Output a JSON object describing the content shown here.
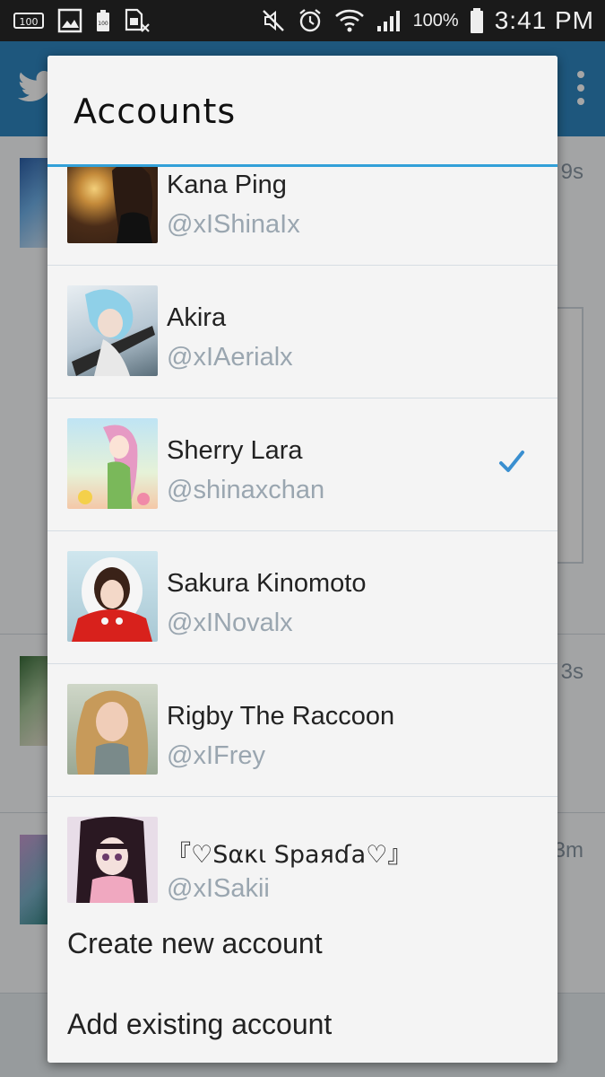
{
  "status_bar": {
    "battery_percent": "100%",
    "time": "3:41 PM",
    "icons": [
      "storage-100-icon",
      "gallery-icon",
      "battery-100-icon",
      "sim-card-icon",
      "mute-icon",
      "alarm-icon",
      "wifi-icon",
      "signal-icon",
      "battery-icon"
    ]
  },
  "background_app": {
    "feed_times": [
      "9s",
      "3s",
      "3m"
    ],
    "accent_color": "#2f86c1"
  },
  "dialog": {
    "title": "Accounts",
    "accounts": [
      {
        "name": "Kana Ping",
        "handle": "@xIShinaIx",
        "selected": false
      },
      {
        "name": "Akira",
        "handle": "@xIAerialx",
        "selected": false
      },
      {
        "name": "Sherry Lara",
        "handle": "@shinaxchan",
        "selected": true
      },
      {
        "name": "Sakura Kinomoto",
        "handle": "@xINovalx",
        "selected": false
      },
      {
        "name": "Rigby The Raccoon",
        "handle": "@xIFrey",
        "selected": false
      },
      {
        "name": "『♡Sακι Spaяɗa♡』",
        "handle": "@xISakii",
        "selected": false
      }
    ],
    "actions": {
      "create": "Create new account",
      "add": "Add existing account"
    },
    "check_color": "#3a8fd0"
  }
}
